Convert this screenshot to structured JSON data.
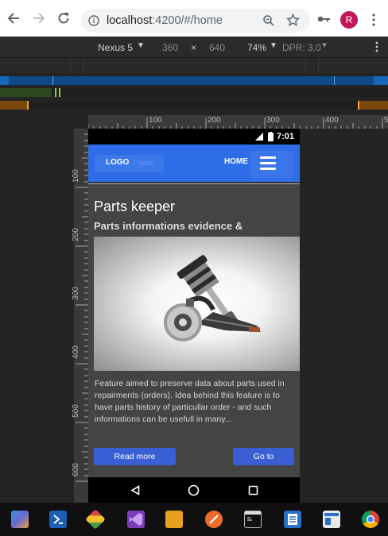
{
  "browser": {
    "url_host": "localhost",
    "url_rest": ":4200/#/home",
    "profile_initial": "R"
  },
  "devtools": {
    "device": "Nexus 5",
    "width": "360",
    "times": "×",
    "height": "640",
    "zoom": "74%",
    "dpr": "DPR: 3.0",
    "ruler_h_labels": [
      "100",
      "200",
      "300",
      "400",
      "5"
    ],
    "ruler_v_labels": [
      "100",
      "200",
      "300",
      "400",
      "500",
      "600"
    ]
  },
  "phone": {
    "status_time": "7:01"
  },
  "app": {
    "logo": "LOGO",
    "logo_ghost": "l more",
    "nav_home": "HOME",
    "card": {
      "title": "Parts keeper",
      "subtitle": "Parts informations evidence &",
      "description": "Feature aimed to preserve data about parts used in repairments (orders). Idea behind this feature is to have parts history of particullar order - and such informations can be usefull in many...",
      "read_more": "Read more",
      "go_to": "Go to"
    }
  },
  "colors": {
    "appbar": "#2f6de8",
    "button": "#3a5fd4",
    "card": "#444444"
  }
}
